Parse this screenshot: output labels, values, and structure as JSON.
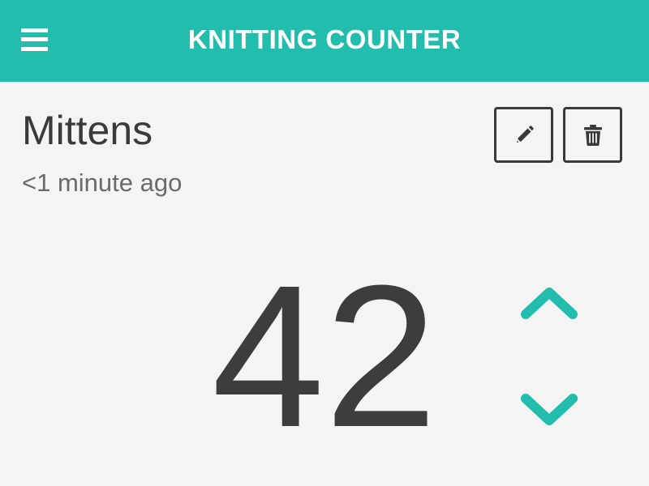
{
  "header": {
    "title": "KNITTING COUNTER",
    "menu_icon": "hamburger-menu-icon",
    "background_color": "#22bdad"
  },
  "counter": {
    "name": "Mittens",
    "updated": "<1 minute ago",
    "value": "42"
  },
  "actions": {
    "edit_icon": "pencil-icon",
    "delete_icon": "trash-icon"
  },
  "controls": {
    "increment_icon": "chevron-up-icon",
    "decrement_icon": "chevron-down-icon",
    "accent_color": "#22bdad"
  }
}
